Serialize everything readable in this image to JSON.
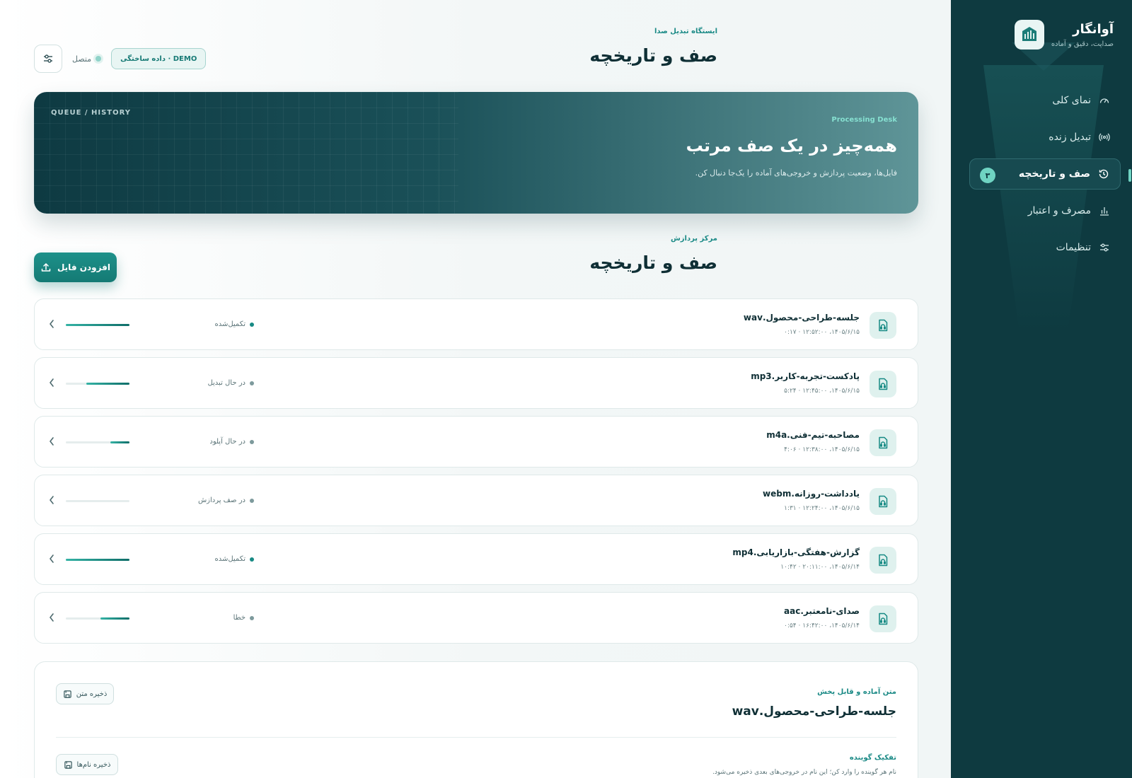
{
  "brand": {
    "title": "آوانگار",
    "subtitle": "صداپت، دقیق و آماده",
    "logo_icon": "waveform-building-icon"
  },
  "sidebar": {
    "items": [
      {
        "label": "نمای کلی",
        "icon": "gauge-icon",
        "active": false
      },
      {
        "label": "تبدیل زنده",
        "icon": "broadcast-icon",
        "active": false
      },
      {
        "label": "صف و تاریخچه",
        "icon": "history-icon",
        "active": true,
        "badge": "۳"
      },
      {
        "label": "مصرف و اعتبار",
        "icon": "bar-chart-icon",
        "active": false
      },
      {
        "label": "تنظیمات",
        "icon": "sliders-icon",
        "active": false
      }
    ]
  },
  "header": {
    "eyebrow": "ایستگاه تبدیل صدا",
    "title": "صف و تاریخچه",
    "status_label": "متصل",
    "demo_badge": "DEMO · داده ساختگی",
    "settings_icon": "sliders-icon"
  },
  "hero": {
    "tag": "QUEUE / HISTORY",
    "eyebrow": "Processing Desk",
    "title": "همه‌چیز در یک صف مرتب",
    "description": "فایل‌ها، وضعیت پردازش و خروجی‌های آماده را یک‌جا دنبال کن."
  },
  "section": {
    "eyebrow": "مرکز پردازش",
    "title": "صف و تاریخچه",
    "add_button_label": "افزودن فایل",
    "add_button_icon": "upload-icon"
  },
  "queue": [
    {
      "name": "جلسه-طراحی-محصول.wav",
      "meta": "۱۴۰۵/۶/۱۵، ۱۲:۵۲:۰۰ · ۰:۱۷",
      "status": "تکمیل‌شده",
      "state": "done",
      "progress": 1.0
    },
    {
      "name": "پادکست-تجربه-کاربر.mp3",
      "meta": "۱۴۰۵/۶/۱۵، ۱۲:۴۵:۰۰ · ۵:۲۴",
      "status": "در حال تبدیل",
      "state": "working",
      "progress": 0.68
    },
    {
      "name": "مصاحبه-تیم-فنی.m4a",
      "meta": "۱۴۰۵/۶/۱۵، ۱۲:۳۸:۰۰ · ۴:۰۶",
      "status": "در حال آپلود",
      "state": "working",
      "progress": 0.3
    },
    {
      "name": "یادداشت-روزانه.webm",
      "meta": "۱۴۰۵/۶/۱۵، ۱۲:۲۴:۰۰ · ۱:۳۱",
      "status": "در صف پردازش",
      "state": "queued",
      "progress": 0.0
    },
    {
      "name": "گزارش-هفتگی-بازاریابی.mp4",
      "meta": "۱۴۰۵/۶/۱۴، ۲۰:۱۱:۰۰ · ۱۰:۴۲",
      "status": "تکمیل‌شده",
      "state": "done",
      "progress": 1.0
    },
    {
      "name": "صدای-نامعتبر.aac",
      "meta": "۱۴۰۵/۶/۱۴، ۱۶:۴۲:۰۰ · ۰:۵۴",
      "status": "خطا",
      "state": "error",
      "progress": 0.46
    }
  ],
  "transcript": {
    "eyebrow": "متن آماده و قابل پخش",
    "title": "جلسه-طراحی-محصول.wav",
    "save_text_label": "ذخیره متن",
    "speaker_eyebrow": "تفکیک گوینده",
    "speaker_desc": "نام هر گوینده را وارد کن؛ این نام در خروجی‌های بعدی ذخیره می‌شود.",
    "save_names_label": "ذخیره نام‌ها",
    "save_icon": "floppy-disk-icon"
  },
  "colors": {
    "accent": "#178a84",
    "sidebar_bg": "#0e3a40",
    "badge": "#6fd3c2"
  }
}
